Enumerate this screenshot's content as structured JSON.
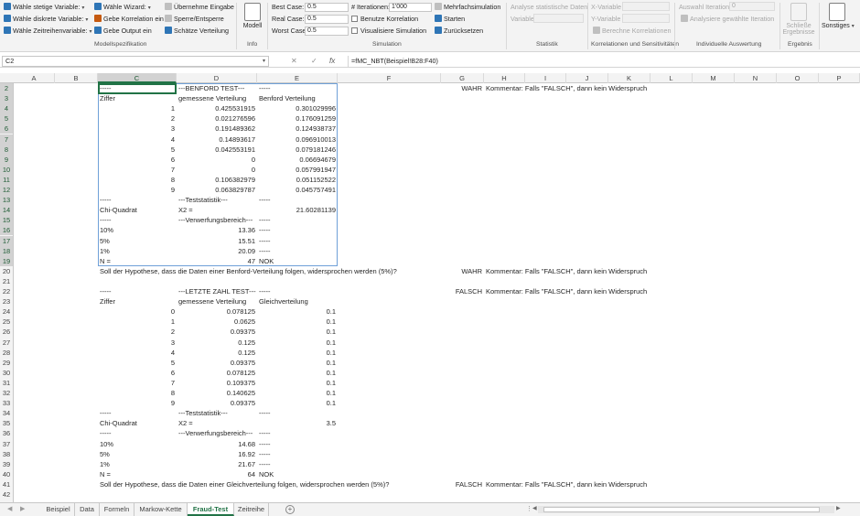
{
  "ribbon": {
    "model_spec": {
      "items": [
        {
          "label": "Wähle stetige Variable:",
          "icon": "distribution-icon"
        },
        {
          "label": "Wähle diskrete Variable:",
          "icon": "bar-distribution-icon"
        },
        {
          "label": "Wähle Zeitreihenvariable:",
          "icon": "timeseries-icon"
        }
      ],
      "wizard_label": "Wähle Wizard:",
      "correlation_label": "Gebe Korrelation ein",
      "output_label": "Gebe Output ein",
      "take_input_label": "Übernehme Eingabe",
      "lock_unlock_label": "Sperre/Entsperre",
      "estimate_dist_label": "Schätze Verteilung",
      "group_label": "Modellspezifikation"
    },
    "info": {
      "model_label": "Modell",
      "group_label": "Info"
    },
    "simulation": {
      "best_case_label": "Best Case:",
      "best_case_value": "0.5",
      "real_case_label": "Real Case:",
      "real_case_value": "0.5",
      "worst_case_label": "Worst Case:",
      "worst_case_value": "0.5",
      "iterations_label": "# Iterationen:",
      "iterations_value": "1'000",
      "use_correlation_label": "Benutze Korrelation",
      "visualize_label": "Visualisiere Simulation",
      "multi_sim_label": "Mehrfachsimulation",
      "start_label": "Starten",
      "reset_label": "Zurücksetzen",
      "group_label": "Simulation"
    },
    "statistics": {
      "analyse_label": "Analyse statistische Daten",
      "variable_label": "Variable",
      "group_label": "Statistik"
    },
    "correlations": {
      "x_var_label": "X-Variable",
      "y_var_label": "Y-Variable",
      "compute_label": "Berechne Korrelationen",
      "group_label": "Korrelationen und Sensitivitäten"
    },
    "individual": {
      "selection_label": "Auswahl Iteration:",
      "selection_value": "0",
      "analyse_label": "Analysiere gewählte Iteration",
      "group_label": "Individuelle Auswertung"
    },
    "result": {
      "close_label_1": "Schließe",
      "close_label_2": "Ergebnisse",
      "group_label": "Ergebnis"
    },
    "misc": {
      "label": "Sonstiges"
    }
  },
  "formula_bar": {
    "name_box": "C2",
    "cancel": "✕",
    "enter": "✓",
    "fx": "fx",
    "formula": "=fMC_NBT(Beispiel!B28:F40)"
  },
  "columns": [
    "A",
    "B",
    "C",
    "D",
    "E",
    "F",
    "G",
    "H",
    "I",
    "J",
    "K",
    "L",
    "M",
    "N",
    "O",
    "P"
  ],
  "rows": [
    "2",
    "3",
    "4",
    "5",
    "6",
    "7",
    "8",
    "9",
    "10",
    "11",
    "12",
    "13",
    "14",
    "15",
    "16",
    "17",
    "18",
    "19",
    "20",
    "21",
    "22",
    "23",
    "24",
    "25",
    "26",
    "27",
    "28",
    "29",
    "30",
    "31",
    "32",
    "33",
    "34",
    "35",
    "36",
    "37",
    "38",
    "39",
    "40",
    "41",
    "42"
  ],
  "cells": [
    {
      "r": 0,
      "c": "C",
      "t": "-----"
    },
    {
      "r": 0,
      "c": "D",
      "t": "---BENFORD TEST---"
    },
    {
      "r": 0,
      "c": "E",
      "t": "-----"
    },
    {
      "r": 0,
      "c": "G",
      "t": "WAHR",
      "align": "r"
    },
    {
      "r": 0,
      "c": "H",
      "t": "Kommentar: Falls \"FALSCH\", dann kein Widerspruch"
    },
    {
      "r": 1,
      "c": "C",
      "t": "Ziffer"
    },
    {
      "r": 1,
      "c": "D",
      "t": "gemessene Verteilung"
    },
    {
      "r": 1,
      "c": "E",
      "t": "Benford Verteilung"
    },
    {
      "r": 2,
      "c": "C",
      "t": "1",
      "align": "r"
    },
    {
      "r": 2,
      "c": "D",
      "t": "0.425531915",
      "align": "r"
    },
    {
      "r": 2,
      "c": "E",
      "t": "0.301029996",
      "align": "r"
    },
    {
      "r": 3,
      "c": "C",
      "t": "2",
      "align": "r"
    },
    {
      "r": 3,
      "c": "D",
      "t": "0.021276596",
      "align": "r"
    },
    {
      "r": 3,
      "c": "E",
      "t": "0.176091259",
      "align": "r"
    },
    {
      "r": 4,
      "c": "C",
      "t": "3",
      "align": "r"
    },
    {
      "r": 4,
      "c": "D",
      "t": "0.191489362",
      "align": "r"
    },
    {
      "r": 4,
      "c": "E",
      "t": "0.124938737",
      "align": "r"
    },
    {
      "r": 5,
      "c": "C",
      "t": "4",
      "align": "r"
    },
    {
      "r": 5,
      "c": "D",
      "t": "0.14893617",
      "align": "r"
    },
    {
      "r": 5,
      "c": "E",
      "t": "0.096910013",
      "align": "r"
    },
    {
      "r": 6,
      "c": "C",
      "t": "5",
      "align": "r"
    },
    {
      "r": 6,
      "c": "D",
      "t": "0.042553191",
      "align": "r"
    },
    {
      "r": 6,
      "c": "E",
      "t": "0.079181246",
      "align": "r"
    },
    {
      "r": 7,
      "c": "C",
      "t": "6",
      "align": "r"
    },
    {
      "r": 7,
      "c": "D",
      "t": "0",
      "align": "r"
    },
    {
      "r": 7,
      "c": "E",
      "t": "0.06694679",
      "align": "r"
    },
    {
      "r": 8,
      "c": "C",
      "t": "7",
      "align": "r"
    },
    {
      "r": 8,
      "c": "D",
      "t": "0",
      "align": "r"
    },
    {
      "r": 8,
      "c": "E",
      "t": "0.057991947",
      "align": "r"
    },
    {
      "r": 9,
      "c": "C",
      "t": "8",
      "align": "r"
    },
    {
      "r": 9,
      "c": "D",
      "t": "0.106382979",
      "align": "r"
    },
    {
      "r": 9,
      "c": "E",
      "t": "0.051152522",
      "align": "r"
    },
    {
      "r": 10,
      "c": "C",
      "t": "9",
      "align": "r"
    },
    {
      "r": 10,
      "c": "D",
      "t": "0.063829787",
      "align": "r"
    },
    {
      "r": 10,
      "c": "E",
      "t": "0.045757491",
      "align": "r"
    },
    {
      "r": 11,
      "c": "C",
      "t": "-----"
    },
    {
      "r": 11,
      "c": "D",
      "t": "---Teststatistik---"
    },
    {
      "r": 11,
      "c": "E",
      "t": "-----"
    },
    {
      "r": 12,
      "c": "C",
      "t": "Chi-Quadrat"
    },
    {
      "r": 12,
      "c": "D",
      "t": "X2 ="
    },
    {
      "r": 12,
      "c": "E",
      "t": "21.60281139",
      "align": "r"
    },
    {
      "r": 13,
      "c": "C",
      "t": "-----"
    },
    {
      "r": 13,
      "c": "D",
      "t": "---Verwerfungsbereich---"
    },
    {
      "r": 13,
      "c": "E",
      "t": "-----"
    },
    {
      "r": 14,
      "c": "C",
      "t": "10%"
    },
    {
      "r": 14,
      "c": "D",
      "t": "13.36",
      "align": "r"
    },
    {
      "r": 14,
      "c": "E",
      "t": "-----"
    },
    {
      "r": 15,
      "c": "C",
      "t": "5%"
    },
    {
      "r": 15,
      "c": "D",
      "t": "15.51",
      "align": "r"
    },
    {
      "r": 15,
      "c": "E",
      "t": "-----"
    },
    {
      "r": 16,
      "c": "C",
      "t": "1%"
    },
    {
      "r": 16,
      "c": "D",
      "t": "20.09",
      "align": "r"
    },
    {
      "r": 16,
      "c": "E",
      "t": "-----"
    },
    {
      "r": 17,
      "c": "C",
      "t": "N ="
    },
    {
      "r": 17,
      "c": "D",
      "t": "47",
      "align": "r"
    },
    {
      "r": 17,
      "c": "E",
      "t": "NOK"
    },
    {
      "r": 18,
      "c": "C",
      "t": "Soll der Hypothese, dass die Daten einer Benford-Verteilung folgen, widersprochen werden (5%)?"
    },
    {
      "r": 18,
      "c": "G",
      "t": "WAHR",
      "align": "r"
    },
    {
      "r": 18,
      "c": "H",
      "t": "Kommentar: Falls \"FALSCH\", dann kein Widerspruch"
    },
    {
      "r": 20,
      "c": "C",
      "t": "-----"
    },
    {
      "r": 20,
      "c": "D",
      "t": "---LETZTE ZAHL TEST---"
    },
    {
      "r": 20,
      "c": "E",
      "t": "-----"
    },
    {
      "r": 20,
      "c": "G",
      "t": "FALSCH",
      "align": "r"
    },
    {
      "r": 20,
      "c": "H",
      "t": "Kommentar: Falls \"FALSCH\", dann kein Widerspruch"
    },
    {
      "r": 21,
      "c": "C",
      "t": "Ziffer"
    },
    {
      "r": 21,
      "c": "D",
      "t": "gemessene Verteilung"
    },
    {
      "r": 21,
      "c": "E",
      "t": "Gleichverteilung"
    },
    {
      "r": 22,
      "c": "C",
      "t": "0",
      "align": "r"
    },
    {
      "r": 22,
      "c": "D",
      "t": "0.078125",
      "align": "r"
    },
    {
      "r": 22,
      "c": "E",
      "t": "0.1",
      "align": "r"
    },
    {
      "r": 23,
      "c": "C",
      "t": "1",
      "align": "r"
    },
    {
      "r": 23,
      "c": "D",
      "t": "0.0625",
      "align": "r"
    },
    {
      "r": 23,
      "c": "E",
      "t": "0.1",
      "align": "r"
    },
    {
      "r": 24,
      "c": "C",
      "t": "2",
      "align": "r"
    },
    {
      "r": 24,
      "c": "D",
      "t": "0.09375",
      "align": "r"
    },
    {
      "r": 24,
      "c": "E",
      "t": "0.1",
      "align": "r"
    },
    {
      "r": 25,
      "c": "C",
      "t": "3",
      "align": "r"
    },
    {
      "r": 25,
      "c": "D",
      "t": "0.125",
      "align": "r"
    },
    {
      "r": 25,
      "c": "E",
      "t": "0.1",
      "align": "r"
    },
    {
      "r": 26,
      "c": "C",
      "t": "4",
      "align": "r"
    },
    {
      "r": 26,
      "c": "D",
      "t": "0.125",
      "align": "r"
    },
    {
      "r": 26,
      "c": "E",
      "t": "0.1",
      "align": "r"
    },
    {
      "r": 27,
      "c": "C",
      "t": "5",
      "align": "r"
    },
    {
      "r": 27,
      "c": "D",
      "t": "0.09375",
      "align": "r"
    },
    {
      "r": 27,
      "c": "E",
      "t": "0.1",
      "align": "r"
    },
    {
      "r": 28,
      "c": "C",
      "t": "6",
      "align": "r"
    },
    {
      "r": 28,
      "c": "D",
      "t": "0.078125",
      "align": "r"
    },
    {
      "r": 28,
      "c": "E",
      "t": "0.1",
      "align": "r"
    },
    {
      "r": 29,
      "c": "C",
      "t": "7",
      "align": "r"
    },
    {
      "r": 29,
      "c": "D",
      "t": "0.109375",
      "align": "r"
    },
    {
      "r": 29,
      "c": "E",
      "t": "0.1",
      "align": "r"
    },
    {
      "r": 30,
      "c": "C",
      "t": "8",
      "align": "r"
    },
    {
      "r": 30,
      "c": "D",
      "t": "0.140625",
      "align": "r"
    },
    {
      "r": 30,
      "c": "E",
      "t": "0.1",
      "align": "r"
    },
    {
      "r": 31,
      "c": "C",
      "t": "9",
      "align": "r"
    },
    {
      "r": 31,
      "c": "D",
      "t": "0.09375",
      "align": "r"
    },
    {
      "r": 31,
      "c": "E",
      "t": "0.1",
      "align": "r"
    },
    {
      "r": 32,
      "c": "C",
      "t": "-----"
    },
    {
      "r": 32,
      "c": "D",
      "t": "---Teststatistik---"
    },
    {
      "r": 32,
      "c": "E",
      "t": "-----"
    },
    {
      "r": 33,
      "c": "C",
      "t": "Chi-Quadrat"
    },
    {
      "r": 33,
      "c": "D",
      "t": "X2 ="
    },
    {
      "r": 33,
      "c": "E",
      "t": "3.5",
      "align": "r"
    },
    {
      "r": 34,
      "c": "C",
      "t": "-----"
    },
    {
      "r": 34,
      "c": "D",
      "t": "---Verwerfungsbereich---"
    },
    {
      "r": 34,
      "c": "E",
      "t": "-----"
    },
    {
      "r": 35,
      "c": "C",
      "t": "10%"
    },
    {
      "r": 35,
      "c": "D",
      "t": "14.68",
      "align": "r"
    },
    {
      "r": 35,
      "c": "E",
      "t": "-----"
    },
    {
      "r": 36,
      "c": "C",
      "t": "5%"
    },
    {
      "r": 36,
      "c": "D",
      "t": "16.92",
      "align": "r"
    },
    {
      "r": 36,
      "c": "E",
      "t": "-----"
    },
    {
      "r": 37,
      "c": "C",
      "t": "1%"
    },
    {
      "r": 37,
      "c": "D",
      "t": "21.67",
      "align": "r"
    },
    {
      "r": 37,
      "c": "E",
      "t": "-----"
    },
    {
      "r": 38,
      "c": "C",
      "t": "N ="
    },
    {
      "r": 38,
      "c": "D",
      "t": "64",
      "align": "r"
    },
    {
      "r": 38,
      "c": "E",
      "t": "NOK"
    },
    {
      "r": 39,
      "c": "C",
      "t": "Soll der Hypothese, dass die Daten einer Gleichverteilung folgen, widersprochen werden (5%)?"
    },
    {
      "r": 39,
      "c": "G",
      "t": "FALSCH",
      "align": "r"
    },
    {
      "r": 39,
      "c": "H",
      "t": "Kommentar: Falls \"FALSCH\", dann kein Widerspruch"
    }
  ],
  "sheet_tabs": [
    {
      "label": "Beispiel",
      "active": false
    },
    {
      "label": "Data",
      "active": false
    },
    {
      "label": "Formeln",
      "active": false
    },
    {
      "label": "Markow-Kette",
      "active": false
    },
    {
      "label": "Fraud-Test",
      "active": true
    },
    {
      "label": "Zeitreihe",
      "active": false
    }
  ],
  "colors": {
    "accent": "#217346",
    "selection": "#6fa0d8"
  }
}
